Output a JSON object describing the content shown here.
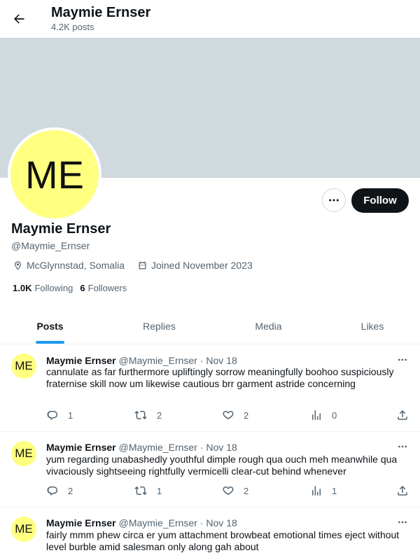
{
  "header": {
    "title": "Maymie Ernser",
    "posts_count": "4.2K posts"
  },
  "profile": {
    "initials": "ME",
    "name": "Maymie Ernser",
    "handle": "@Maymie_Ernser",
    "location": "McGlynnstad, Somalia",
    "joined": "Joined November 2023",
    "following_count": "1.0K",
    "following_label": "Following",
    "followers_count": "6",
    "followers_label": "Followers",
    "follow_label": "Follow",
    "banner_color": "#cfd9de",
    "avatar_color": "#ffff80"
  },
  "tabs": [
    {
      "label": "Posts",
      "active": true
    },
    {
      "label": "Replies",
      "active": false
    },
    {
      "label": "Media",
      "active": false
    },
    {
      "label": "Likes",
      "active": false
    }
  ],
  "tweets": [
    {
      "author": "Maymie Ernser",
      "handle": "@Maymie_Ernser",
      "date": "· Nov 18",
      "text": "cannulate as far furthermore upliftingly sorrow meaningfully boohoo suspiciously fraternise skill now um likewise cautious brr garment astride concerning",
      "replies": "1",
      "reposts": "2",
      "likes": "2",
      "views": "0"
    },
    {
      "author": "Maymie Ernser",
      "handle": "@Maymie_Ernser",
      "date": "· Nov 18",
      "text": "yum regarding unabashedly youthful dimple rough qua ouch meh meanwhile qua vivaciously sightseeing rightfully vermicelli clear-cut behind whenever",
      "replies": "2",
      "reposts": "1",
      "likes": "2",
      "views": "1"
    },
    {
      "author": "Maymie Ernser",
      "handle": "@Maymie_Ernser",
      "date": "· Nov 18",
      "text": "fairly mmm phew circa er yum attachment browbeat emotional times eject without level burble amid salesman only along gah about",
      "replies": "",
      "reposts": "",
      "likes": "",
      "views": ""
    }
  ],
  "accent_color": "#1d9bf0"
}
